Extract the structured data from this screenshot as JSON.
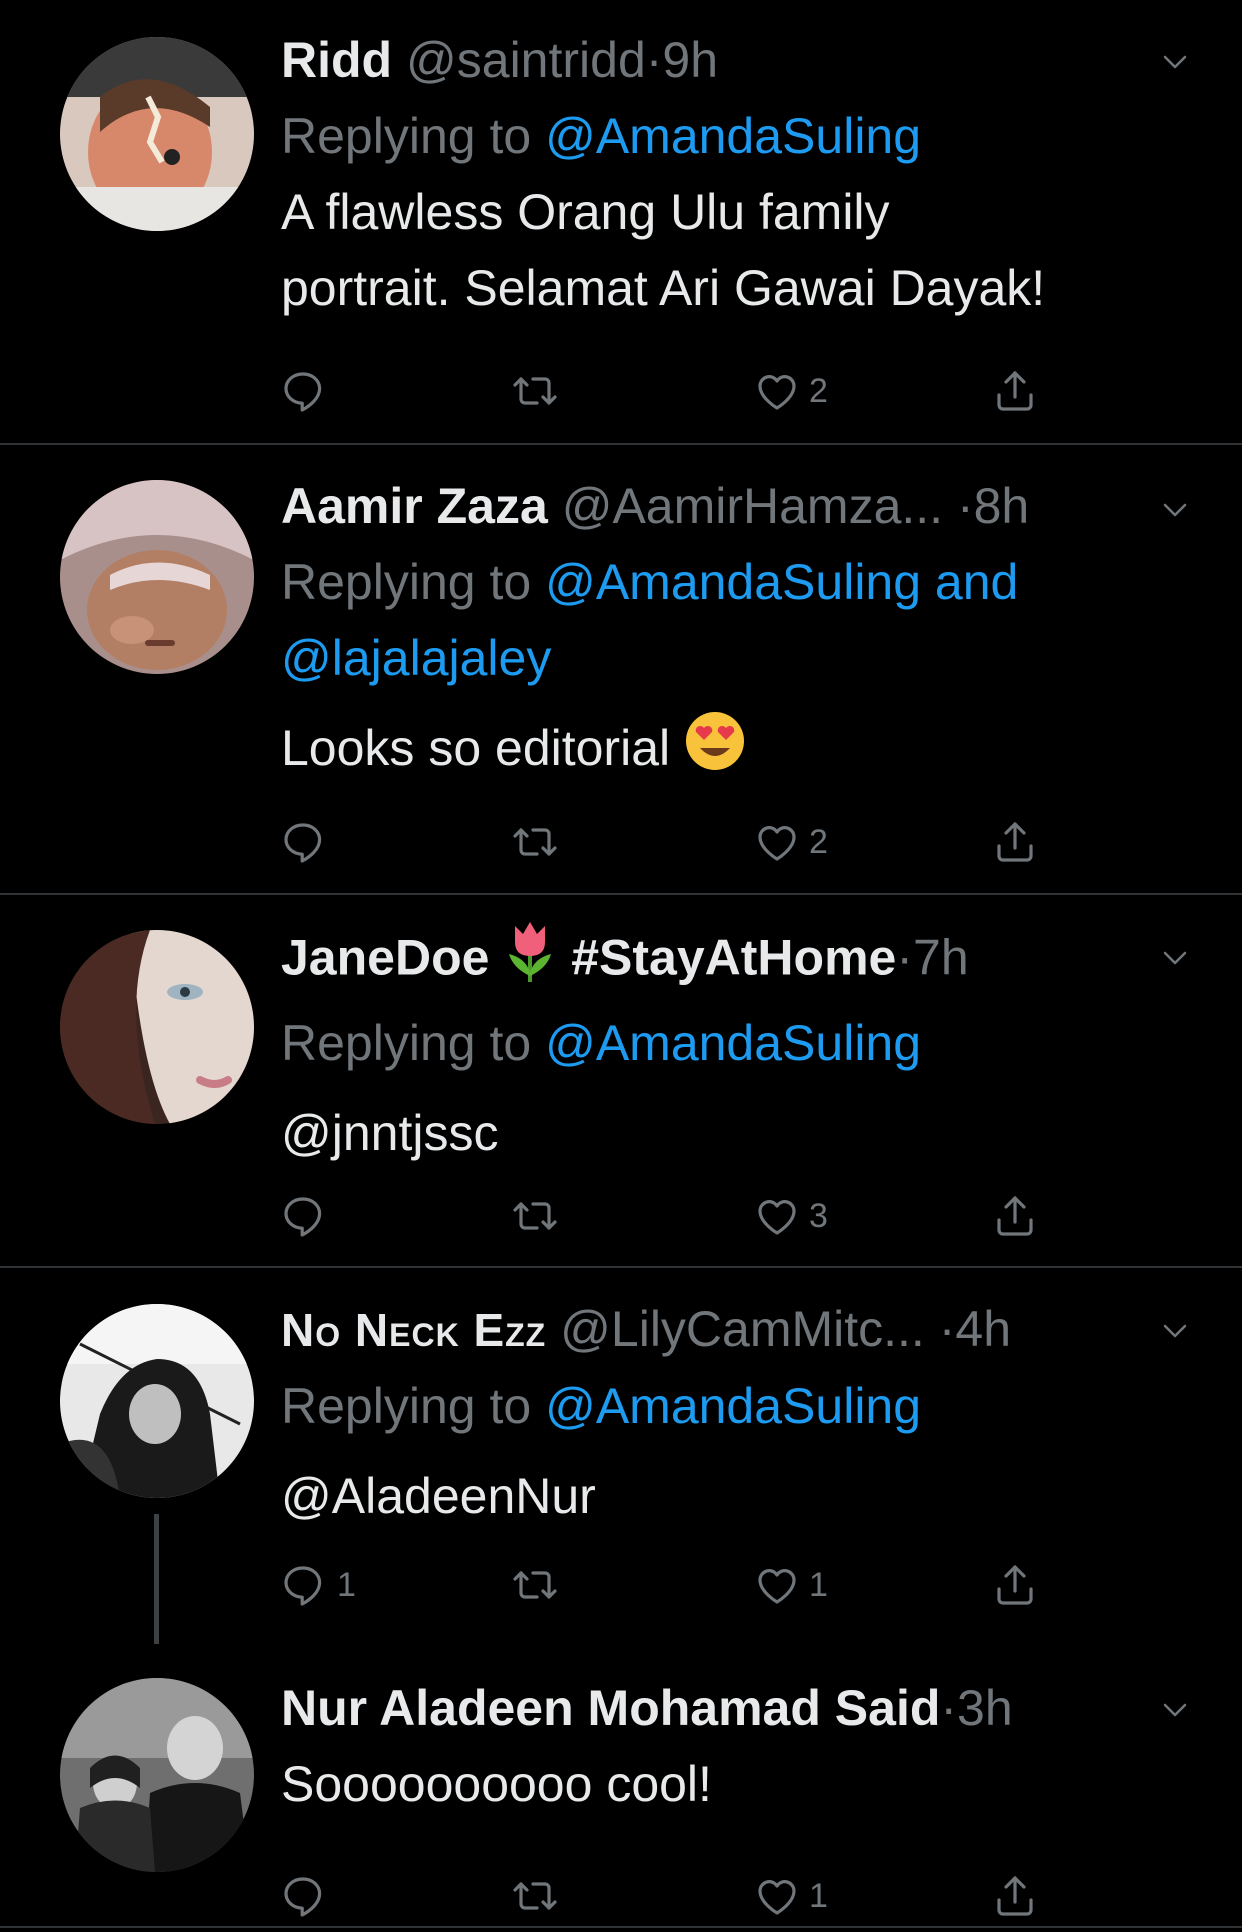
{
  "tweets": [
    {
      "display_name": "Ridd",
      "handle": "@saintridd",
      "separator": "·",
      "time": "9h",
      "replying_prefix": "Replying to",
      "replying_to": "@AmandaSuling",
      "body_line1": "A flawless Orang Ulu family",
      "body_line2": "portrait. Selamat Ari Gawai Dayak!",
      "reply_count": "",
      "retweet_count": "",
      "like_count": "2"
    },
    {
      "display_name": "Aamir Zaza",
      "handle": "@AamirHamza...",
      "separator": "·",
      "time": "8h",
      "replying_prefix": "Replying to",
      "replying_to": "@AmandaSuling and",
      "replying_to_line2": "@lajalajaley",
      "body": "Looks so editorial",
      "body_emoji": "heart-eyes-emoji",
      "reply_count": "",
      "retweet_count": "",
      "like_count": "2"
    },
    {
      "display_name": "JaneDoe",
      "name_emoji": "tulip-emoji",
      "hashtag": "#StayAtHome",
      "separator": "·",
      "time": "7h",
      "replying_prefix": "Replying to",
      "replying_to": "@AmandaSuling",
      "body": "@jnntjssc",
      "reply_count": "",
      "retweet_count": "",
      "like_count": "3"
    },
    {
      "display_name": "No Neck Ezz",
      "handle": "@LilyCamMitc...",
      "separator": "·",
      "time": "4h",
      "replying_prefix": "Replying to",
      "replying_to": "@AmandaSuling",
      "body": "@AladeenNur",
      "reply_count": "1",
      "retweet_count": "",
      "like_count": "1"
    },
    {
      "display_name": "Nur Aladeen Mohamad Said",
      "separator": "·",
      "time": "3h",
      "body": "Soooooooooo cool!",
      "reply_count": "",
      "retweet_count": "",
      "like_count": "1"
    }
  ],
  "colors": {
    "background": "#000000",
    "text": "#e7e9ea",
    "muted": "#71767b",
    "link": "#1d9bf0",
    "divider": "#2f3336"
  },
  "icons": [
    "reply-icon",
    "retweet-icon",
    "like-icon",
    "share-icon",
    "caret-down-icon"
  ]
}
